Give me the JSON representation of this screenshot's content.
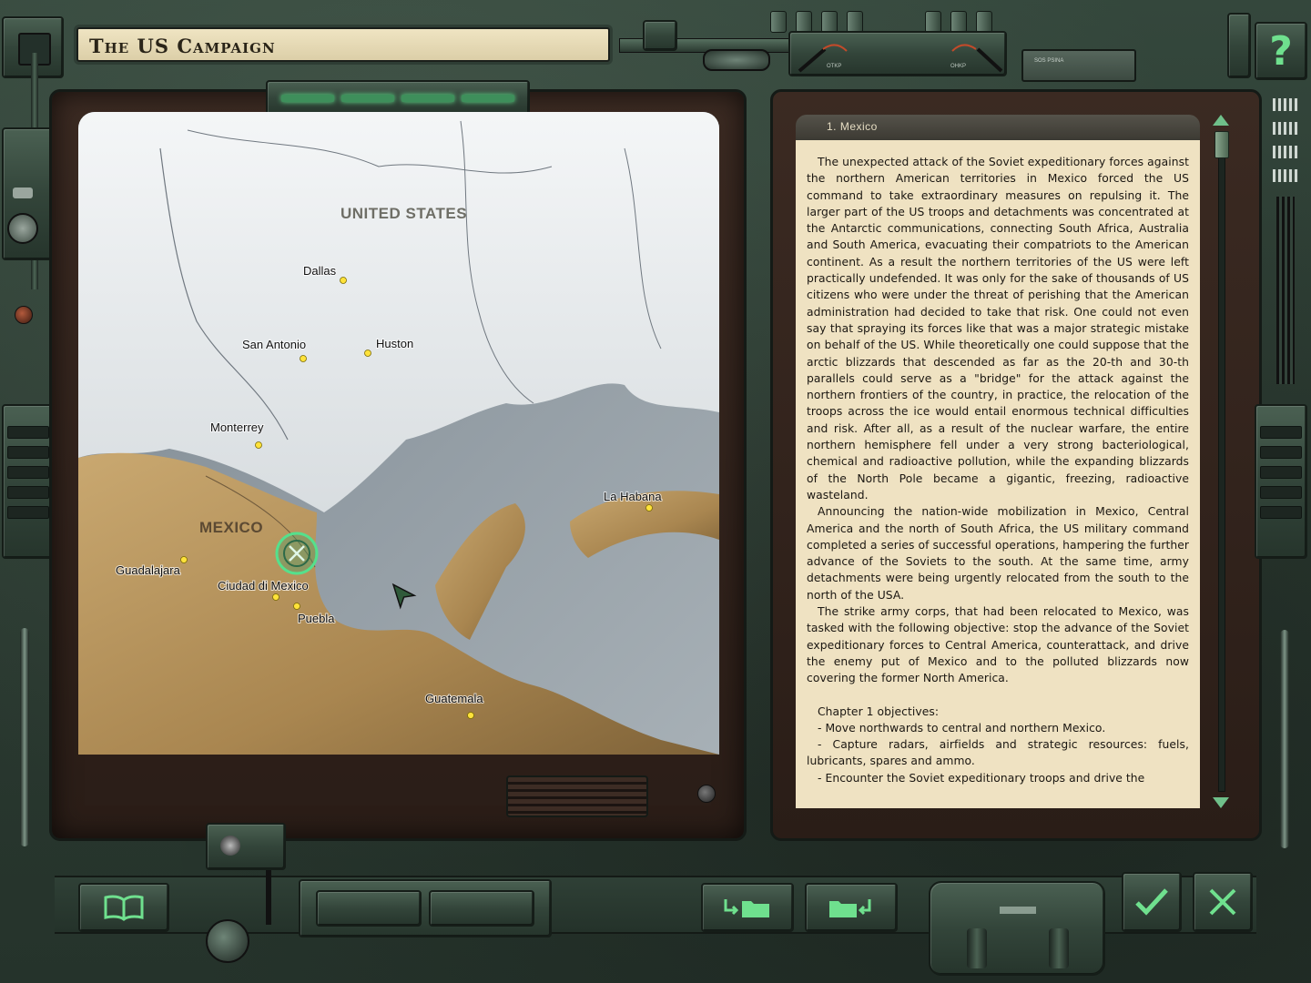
{
  "window": {
    "title": "The US Campaign",
    "help_label": "?"
  },
  "map": {
    "countries": [
      {
        "name": "UNITED STATES"
      },
      {
        "name": "MEXICO"
      }
    ],
    "cities": [
      {
        "name": "Dallas"
      },
      {
        "name": "San Antonio"
      },
      {
        "name": "Huston"
      },
      {
        "name": "Monterrey"
      },
      {
        "name": "La Habana"
      },
      {
        "name": "Guadalajara"
      },
      {
        "name": "Ciudad di Mexico"
      },
      {
        "name": "Puebla"
      },
      {
        "name": "Guatemala"
      }
    ]
  },
  "briefing": {
    "mission_title": "1. Mexico",
    "paragraphs": [
      "The unexpected attack of the Soviet expeditionary forces against the northern American territories in Mexico forced the US command to take extraordinary measures on repulsing it. The larger part of the US troops and detachments was concentrated at the Antarctic communications, connecting South Africa, Australia and South America, evacuating their compatriots to the American continent. As a result the northern territories of the US were left practically undefended. It was only for the sake of thousands of US citizens who were under the threat of perishing that the American administration had decided to take that risk. One could not even say that spraying its forces like that was a major strategic mistake on behalf of the US. While theoretically one could suppose that the arctic blizzards that descended as far as the 20-th and 30-th parallels could serve as a \"bridge\" for the attack against the northern frontiers of the country, in practice, the relocation of the troops across the ice would entail enormous technical difficulties and risk. After all, as a result of the nuclear warfare, the entire northern hemisphere fell under a very strong bacteriological, chemical and radioactive pollution, while the expanding blizzards of the North Pole became a gigantic, freezing, radioactive wasteland.",
      "Announcing the nation-wide mobilization in Mexico, Central America and the north of South Africa, the US military command completed a series of successful operations, hampering the further advance of the Soviets to the south. At the same time, army detachments were being urgently relocated from the south to the north of the USA.",
      "The strike army corps, that had been relocated to Mexico, was tasked with the following objective: stop the advance of the Soviet expeditionary forces to Central America, counterattack, and drive the enemy put of Mexico and to the polluted blizzards now covering the former North America."
    ],
    "objectives_title": "Chapter 1 objectives:",
    "objectives": [
      "- Move northwards to central and northern Mexico.",
      "- Capture radars, airfields and strategic resources: fuels, lubricants, spares and ammo.",
      "- Encounter the Soviet expeditionary troops and drive the"
    ]
  },
  "gauges": {
    "left_label": "OTKP",
    "right_label": "OHKP",
    "screen_label": "SOS  PSINA"
  },
  "colors": {
    "accent": "#6fe08e",
    "paper": "#efe2c2",
    "frame": "#2f4036"
  },
  "icons": {
    "encyclopedia": "book-icon",
    "load": "folder-open-icon",
    "save": "folder-save-icon",
    "accept": "check-icon",
    "cancel": "close-icon",
    "help": "question-icon"
  }
}
